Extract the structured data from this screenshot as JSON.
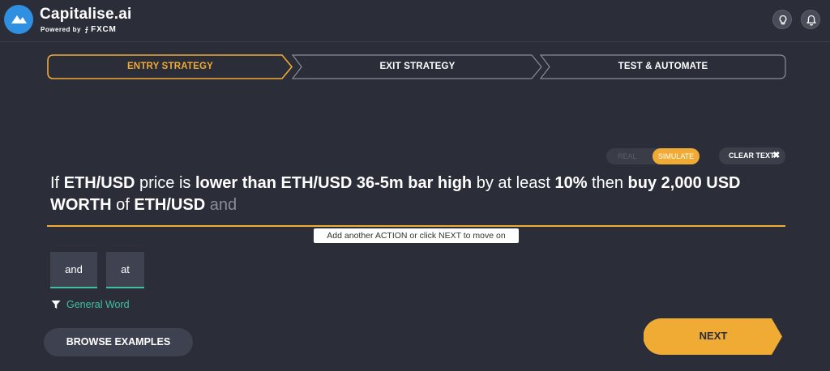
{
  "brand": {
    "name": "Capitalise.ai",
    "powered_by": "Powered by",
    "partner": "FXCM"
  },
  "steps": [
    {
      "label": "ENTRY STRATEGY",
      "active": true
    },
    {
      "label": "EXIT STRATEGY",
      "active": false
    },
    {
      "label": "TEST & AUTOMATE",
      "active": false
    }
  ],
  "mode_toggle": {
    "real_label": "REAL",
    "simulate_label": "SIMULATE",
    "selected": "SIMULATE"
  },
  "clear_text_label": "CLEAR TEXT",
  "sentence": {
    "p1": "If",
    "p2": "ETH/USD",
    "p3": "price is",
    "p4": "lower than",
    "p5": "ETH/USD 36-5m bar high",
    "p6": "by at least",
    "p7": "10%",
    "p8": "then",
    "p9": "buy",
    "p10": "2,000 USD WORTH",
    "p11": "of",
    "p12": "ETH/USD",
    "p13": "and"
  },
  "tooltip": "Add another ACTION or click NEXT to move on",
  "word_options": [
    "and",
    "at"
  ],
  "filter_label": "General Word",
  "browse_label": "BROWSE EXAMPLES",
  "next_label": "NEXT",
  "colors": {
    "background": "#2b2d38",
    "accent": "#f0ab35",
    "teal": "#3fc0a3",
    "logo": "#2f8fe0"
  }
}
